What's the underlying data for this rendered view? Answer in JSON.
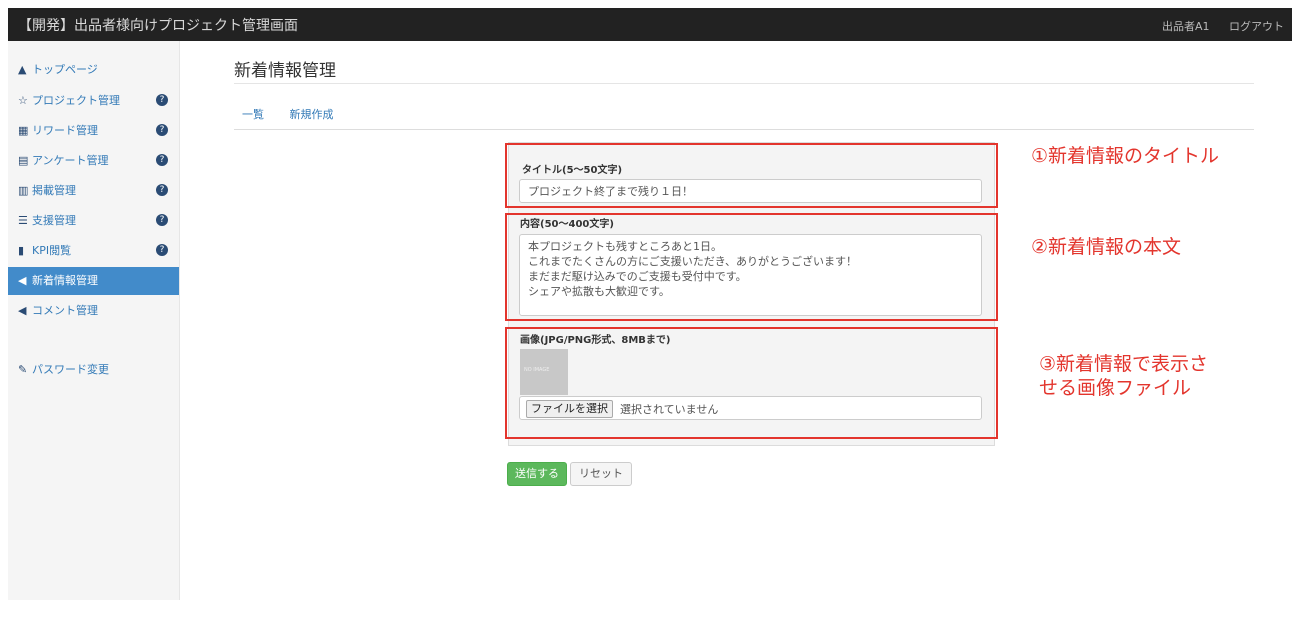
{
  "header": {
    "brand": "【開発】出品者様向けプロジェクト管理画面",
    "user": "出品者A1",
    "logout": "ログアウト"
  },
  "sidebar": {
    "items": [
      {
        "icon": "home-icon",
        "glyph": "🏠",
        "label": "トップページ",
        "help": false
      },
      {
        "icon": "star-icon",
        "glyph": "☆",
        "label": "プロジェクト管理",
        "help": true
      },
      {
        "icon": "gift-icon",
        "glyph": "▦",
        "label": "リワード管理",
        "help": true
      },
      {
        "icon": "survey-icon",
        "glyph": "▤",
        "label": "アンケート管理",
        "help": true
      },
      {
        "icon": "listing-icon",
        "glyph": "▥",
        "label": "掲載管理",
        "help": true
      },
      {
        "icon": "list-icon",
        "glyph": "☰",
        "label": "支援管理",
        "help": true
      },
      {
        "icon": "bar-chart-icon",
        "glyph": "▮",
        "label": "KPI閲覧",
        "help": true
      },
      {
        "icon": "send-icon",
        "glyph": "◀",
        "label": "新着情報管理",
        "help": false
      },
      {
        "icon": "megaphone-icon",
        "glyph": "◀",
        "label": "コメント管理",
        "help": false
      },
      {
        "icon": "wrench-icon",
        "glyph": "✎",
        "label": "パスワード変更",
        "help": false
      }
    ],
    "active_index": 7,
    "help_glyph": "?"
  },
  "main": {
    "title": "新着情報管理",
    "tabs": [
      "一覧",
      "新規作成"
    ]
  },
  "form": {
    "title_label": "タイトル(5〜50文字)",
    "title_value": "プロジェクト終了まで残り１日！",
    "body_label": "内容(50〜400文字)",
    "body_value": "本プロジェクトも残すところあと1日。\nこれまでたくさんの方にご支援いただき、ありがとうございます！\nまだまだ駆け込みでのご支援も受付中です。\nシェアや拡散も大歓迎です。",
    "image_label": "画像(JPG/PNG形式、8MBまで)",
    "no_image": "NO IMAGE",
    "file_button": "ファイルを選択",
    "file_status": "選択されていません",
    "submit": "送信する",
    "reset": "リセット"
  },
  "annotations": {
    "title": "①新着情報のタイトル",
    "body": "②新着情報の本文",
    "image_line1": "③新着情報で表示さ",
    "image_line2": "せる画像ファイル"
  },
  "colors": {
    "annotation": "#e3352d",
    "navbar": "#222222",
    "active": "#428bca",
    "submit": "#5cb85c"
  }
}
